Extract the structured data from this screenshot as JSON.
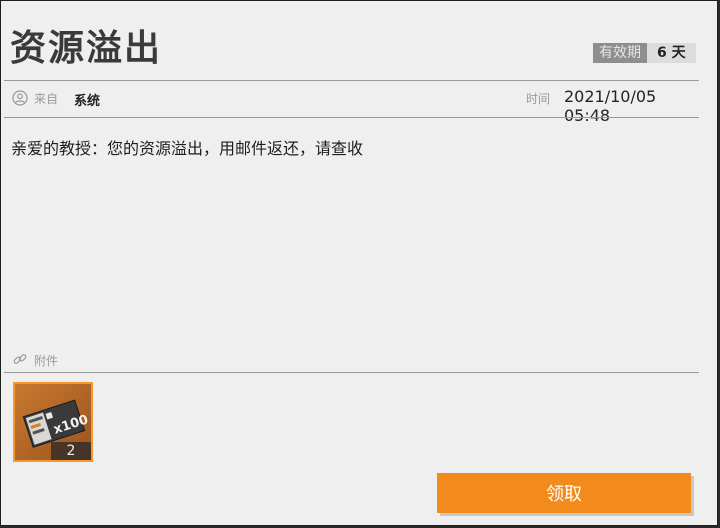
{
  "mail": {
    "title": "资源溢出",
    "validity_label": "有效期",
    "validity_value": "6 天",
    "from_label": "来自",
    "from_value": "系统",
    "time_label": "时间",
    "time_value": "2021/10/05 05:48",
    "message": "亲爱的教授：您的资源溢出，用邮件返还，请查收"
  },
  "attachments": {
    "label": "附件",
    "items": [
      {
        "icon": "ticket-icon",
        "art_text": "x100",
        "count": "2"
      }
    ]
  },
  "actions": {
    "claim_label": "领取"
  },
  "colors": {
    "accent": "#f28a1c",
    "item_border": "#f29a2e",
    "panel_bg": "#efefef"
  }
}
